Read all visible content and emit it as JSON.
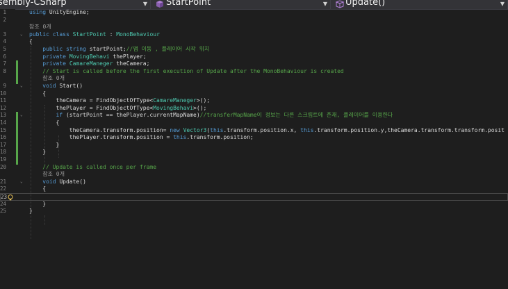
{
  "navigation": {
    "project": "sembly-CSharp",
    "class": "StartPoint",
    "method": "Update()"
  },
  "current_line": 23,
  "lines": [
    {
      "n": "1",
      "fold": "",
      "tokens": [
        {
          "t": "using",
          "c": "kw"
        },
        {
          "t": " UnityEngine;",
          "c": "pl"
        }
      ]
    },
    {
      "n": "2",
      "fold": "",
      "tokens": []
    },
    {
      "n": "",
      "fold": "",
      "tokens": [
        {
          "t": "참조 0개",
          "c": "ref"
        }
      ]
    },
    {
      "n": "3",
      "fold": "⌄",
      "tokens": [
        {
          "t": "public",
          "c": "kw"
        },
        {
          "t": " ",
          "c": "pl"
        },
        {
          "t": "class",
          "c": "kw"
        },
        {
          "t": " ",
          "c": "pl"
        },
        {
          "t": "StartPoint",
          "c": "ty"
        },
        {
          "t": " : ",
          "c": "pl"
        },
        {
          "t": "MonoBehaviour",
          "c": "ty"
        }
      ]
    },
    {
      "n": "4",
      "fold": "",
      "tokens": [
        {
          "t": "{",
          "c": "pl"
        }
      ]
    },
    {
      "n": "5",
      "fold": "",
      "tokens": [
        {
          "t": "    ",
          "c": "pl"
        },
        {
          "t": "public",
          "c": "kw"
        },
        {
          "t": " ",
          "c": "pl"
        },
        {
          "t": "string",
          "c": "kw"
        },
        {
          "t": " startPoint;",
          "c": "pl"
        },
        {
          "t": "//맵 이동 , 플레이어 시작 위치",
          "c": "cm"
        }
      ]
    },
    {
      "n": "6",
      "fold": "",
      "tokens": [
        {
          "t": "    ",
          "c": "pl"
        },
        {
          "t": "private",
          "c": "kw"
        },
        {
          "t": " ",
          "c": "pl"
        },
        {
          "t": "MovingBehavi",
          "c": "ty"
        },
        {
          "t": " thePlayer;",
          "c": "pl"
        }
      ]
    },
    {
      "n": "7",
      "fold": "",
      "tokens": [
        {
          "t": "    ",
          "c": "pl"
        },
        {
          "t": "private",
          "c": "kw"
        },
        {
          "t": " ",
          "c": "pl"
        },
        {
          "t": "CamareManeger",
          "c": "ty"
        },
        {
          "t": " theCamera;",
          "c": "pl"
        }
      ]
    },
    {
      "n": "8",
      "fold": "",
      "tokens": [
        {
          "t": "    ",
          "c": "pl"
        },
        {
          "t": "// Start is called before the first execution of Update after the MonoBehaviour is created",
          "c": "cm"
        }
      ]
    },
    {
      "n": "",
      "fold": "",
      "tokens": [
        {
          "t": "    ",
          "c": "pl"
        },
        {
          "t": "참조 0개",
          "c": "ref"
        }
      ]
    },
    {
      "n": "9",
      "fold": "⌄",
      "tokens": [
        {
          "t": "    ",
          "c": "pl"
        },
        {
          "t": "void",
          "c": "kw"
        },
        {
          "t": " Start()",
          "c": "pl"
        }
      ]
    },
    {
      "n": "10",
      "fold": "",
      "tokens": [
        {
          "t": "    {",
          "c": "pl"
        }
      ]
    },
    {
      "n": "11",
      "fold": "",
      "tokens": [
        {
          "t": "        theCamera = FindObjectOfType<",
          "c": "pl"
        },
        {
          "t": "CamareManeger",
          "c": "ty"
        },
        {
          "t": ">();",
          "c": "pl"
        }
      ]
    },
    {
      "n": "12",
      "fold": "",
      "tokens": [
        {
          "t": "        thePlayer = FindObjectOfType<",
          "c": "pl"
        },
        {
          "t": "MovingBehavi",
          "c": "ty"
        },
        {
          "t": ">();",
          "c": "pl"
        }
      ]
    },
    {
      "n": "13",
      "fold": "⌄",
      "tokens": [
        {
          "t": "        ",
          "c": "pl"
        },
        {
          "t": "if",
          "c": "kw"
        },
        {
          "t": " (startPoint == thePlayer.currentMapName)",
          "c": "pl"
        },
        {
          "t": "//transferMapName이 정보는 다른 스크립트에 존재, 플레이어를 이용한다",
          "c": "cm"
        }
      ]
    },
    {
      "n": "14",
      "fold": "",
      "tokens": [
        {
          "t": "        {",
          "c": "pl"
        }
      ]
    },
    {
      "n": "15",
      "fold": "",
      "tokens": [
        {
          "t": "            theCamera.transform.position= ",
          "c": "pl"
        },
        {
          "t": "new",
          "c": "kw"
        },
        {
          "t": " ",
          "c": "pl"
        },
        {
          "t": "Vector3",
          "c": "ty"
        },
        {
          "t": "(",
          "c": "pl"
        },
        {
          "t": "this",
          "c": "kw"
        },
        {
          "t": ".transform.position.x, ",
          "c": "pl"
        },
        {
          "t": "this",
          "c": "kw"
        },
        {
          "t": ".transform.position.y,theCamera.transform.transform.posit",
          "c": "pl"
        }
      ]
    },
    {
      "n": "16",
      "fold": "",
      "tokens": [
        {
          "t": "            thePlayer.transform.position = ",
          "c": "pl"
        },
        {
          "t": "this",
          "c": "kw"
        },
        {
          "t": ".transform.position;",
          "c": "pl"
        }
      ]
    },
    {
      "n": "17",
      "fold": "",
      "tokens": [
        {
          "t": "        }",
          "c": "pl"
        }
      ]
    },
    {
      "n": "18",
      "fold": "",
      "tokens": [
        {
          "t": "    }",
          "c": "pl"
        }
      ]
    },
    {
      "n": "19",
      "fold": "",
      "tokens": []
    },
    {
      "n": "20",
      "fold": "",
      "tokens": [
        {
          "t": "    ",
          "c": "pl"
        },
        {
          "t": "// Update is called once per frame",
          "c": "cm"
        }
      ]
    },
    {
      "n": "",
      "fold": "",
      "tokens": [
        {
          "t": "    ",
          "c": "pl"
        },
        {
          "t": "참조 0개",
          "c": "ref"
        }
      ]
    },
    {
      "n": "21",
      "fold": "⌄",
      "tokens": [
        {
          "t": "    ",
          "c": "pl"
        },
        {
          "t": "void",
          "c": "kw"
        },
        {
          "t": " Update()",
          "c": "pl"
        }
      ]
    },
    {
      "n": "22",
      "fold": "",
      "tokens": [
        {
          "t": "    {",
          "c": "pl"
        }
      ]
    },
    {
      "n": "23",
      "fold": "",
      "tokens": []
    },
    {
      "n": "24",
      "fold": "",
      "tokens": [
        {
          "t": "    }",
          "c": "pl"
        }
      ]
    },
    {
      "n": "25",
      "fold": "",
      "tokens": [
        {
          "t": "}",
          "c": "pl"
        }
      ]
    }
  ],
  "colors": {
    "keyword": "#569cd6",
    "type": "#4ec9b0",
    "comment": "#57a64a",
    "text": "#dcdcdc",
    "line_number": "#858585",
    "background": "#1e1e1e"
  },
  "icons": {
    "project": "csharp-project-icon",
    "class": "class-cube-icon",
    "method": "method-cube-icon",
    "quick_action": "lightbulb-icon"
  }
}
